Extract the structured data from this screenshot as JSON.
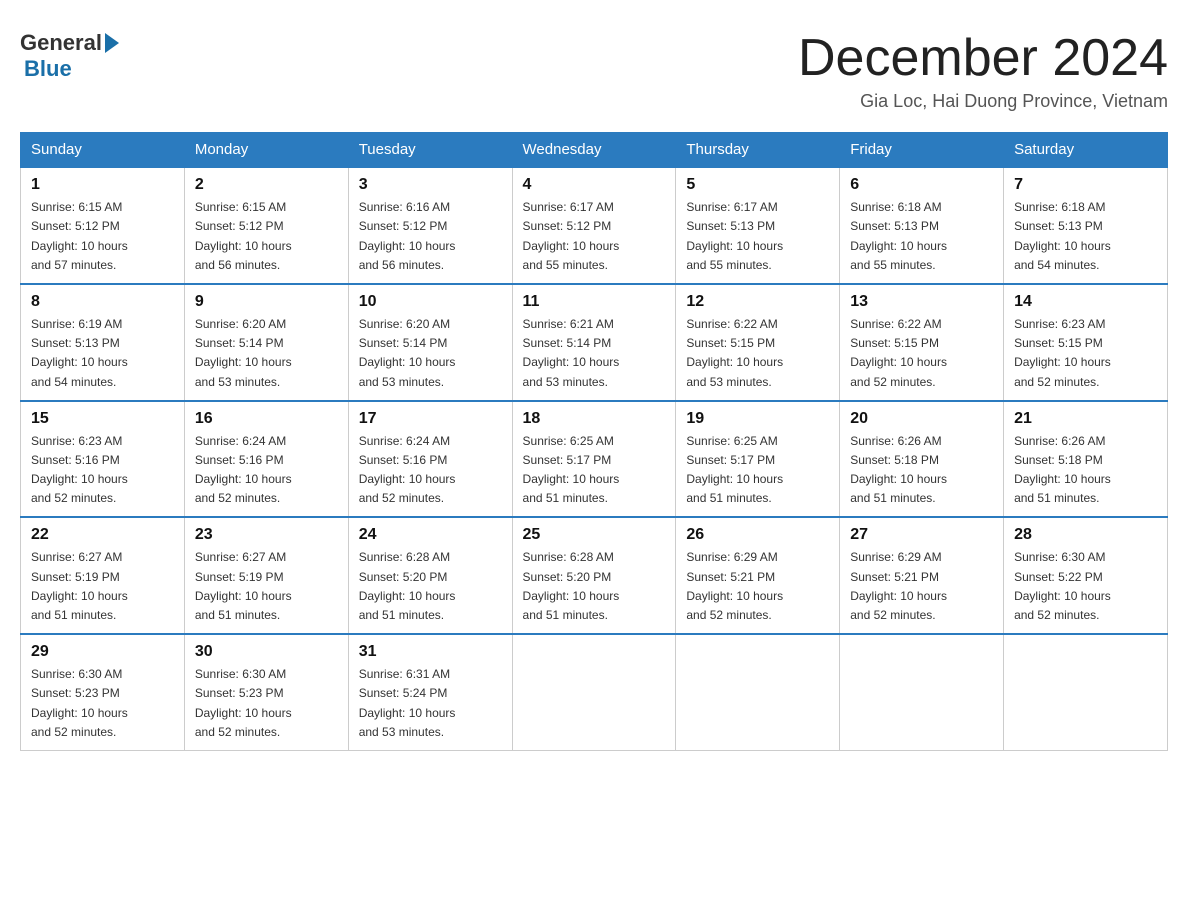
{
  "header": {
    "logo_general": "General",
    "logo_blue": "Blue",
    "title": "December 2024",
    "subtitle": "Gia Loc, Hai Duong Province, Vietnam"
  },
  "days_of_week": [
    "Sunday",
    "Monday",
    "Tuesday",
    "Wednesday",
    "Thursday",
    "Friday",
    "Saturday"
  ],
  "weeks": [
    [
      {
        "day": "1",
        "sunrise": "6:15 AM",
        "sunset": "5:12 PM",
        "daylight": "10 hours and 57 minutes."
      },
      {
        "day": "2",
        "sunrise": "6:15 AM",
        "sunset": "5:12 PM",
        "daylight": "10 hours and 56 minutes."
      },
      {
        "day": "3",
        "sunrise": "6:16 AM",
        "sunset": "5:12 PM",
        "daylight": "10 hours and 56 minutes."
      },
      {
        "day": "4",
        "sunrise": "6:17 AM",
        "sunset": "5:12 PM",
        "daylight": "10 hours and 55 minutes."
      },
      {
        "day": "5",
        "sunrise": "6:17 AM",
        "sunset": "5:13 PM",
        "daylight": "10 hours and 55 minutes."
      },
      {
        "day": "6",
        "sunrise": "6:18 AM",
        "sunset": "5:13 PM",
        "daylight": "10 hours and 55 minutes."
      },
      {
        "day": "7",
        "sunrise": "6:18 AM",
        "sunset": "5:13 PM",
        "daylight": "10 hours and 54 minutes."
      }
    ],
    [
      {
        "day": "8",
        "sunrise": "6:19 AM",
        "sunset": "5:13 PM",
        "daylight": "10 hours and 54 minutes."
      },
      {
        "day": "9",
        "sunrise": "6:20 AM",
        "sunset": "5:14 PM",
        "daylight": "10 hours and 53 minutes."
      },
      {
        "day": "10",
        "sunrise": "6:20 AM",
        "sunset": "5:14 PM",
        "daylight": "10 hours and 53 minutes."
      },
      {
        "day": "11",
        "sunrise": "6:21 AM",
        "sunset": "5:14 PM",
        "daylight": "10 hours and 53 minutes."
      },
      {
        "day": "12",
        "sunrise": "6:22 AM",
        "sunset": "5:15 PM",
        "daylight": "10 hours and 53 minutes."
      },
      {
        "day": "13",
        "sunrise": "6:22 AM",
        "sunset": "5:15 PM",
        "daylight": "10 hours and 52 minutes."
      },
      {
        "day": "14",
        "sunrise": "6:23 AM",
        "sunset": "5:15 PM",
        "daylight": "10 hours and 52 minutes."
      }
    ],
    [
      {
        "day": "15",
        "sunrise": "6:23 AM",
        "sunset": "5:16 PM",
        "daylight": "10 hours and 52 minutes."
      },
      {
        "day": "16",
        "sunrise": "6:24 AM",
        "sunset": "5:16 PM",
        "daylight": "10 hours and 52 minutes."
      },
      {
        "day": "17",
        "sunrise": "6:24 AM",
        "sunset": "5:16 PM",
        "daylight": "10 hours and 52 minutes."
      },
      {
        "day": "18",
        "sunrise": "6:25 AM",
        "sunset": "5:17 PM",
        "daylight": "10 hours and 51 minutes."
      },
      {
        "day": "19",
        "sunrise": "6:25 AM",
        "sunset": "5:17 PM",
        "daylight": "10 hours and 51 minutes."
      },
      {
        "day": "20",
        "sunrise": "6:26 AM",
        "sunset": "5:18 PM",
        "daylight": "10 hours and 51 minutes."
      },
      {
        "day": "21",
        "sunrise": "6:26 AM",
        "sunset": "5:18 PM",
        "daylight": "10 hours and 51 minutes."
      }
    ],
    [
      {
        "day": "22",
        "sunrise": "6:27 AM",
        "sunset": "5:19 PM",
        "daylight": "10 hours and 51 minutes."
      },
      {
        "day": "23",
        "sunrise": "6:27 AM",
        "sunset": "5:19 PM",
        "daylight": "10 hours and 51 minutes."
      },
      {
        "day": "24",
        "sunrise": "6:28 AM",
        "sunset": "5:20 PM",
        "daylight": "10 hours and 51 minutes."
      },
      {
        "day": "25",
        "sunrise": "6:28 AM",
        "sunset": "5:20 PM",
        "daylight": "10 hours and 51 minutes."
      },
      {
        "day": "26",
        "sunrise": "6:29 AM",
        "sunset": "5:21 PM",
        "daylight": "10 hours and 52 minutes."
      },
      {
        "day": "27",
        "sunrise": "6:29 AM",
        "sunset": "5:21 PM",
        "daylight": "10 hours and 52 minutes."
      },
      {
        "day": "28",
        "sunrise": "6:30 AM",
        "sunset": "5:22 PM",
        "daylight": "10 hours and 52 minutes."
      }
    ],
    [
      {
        "day": "29",
        "sunrise": "6:30 AM",
        "sunset": "5:23 PM",
        "daylight": "10 hours and 52 minutes."
      },
      {
        "day": "30",
        "sunrise": "6:30 AM",
        "sunset": "5:23 PM",
        "daylight": "10 hours and 52 minutes."
      },
      {
        "day": "31",
        "sunrise": "6:31 AM",
        "sunset": "5:24 PM",
        "daylight": "10 hours and 53 minutes."
      },
      null,
      null,
      null,
      null
    ]
  ],
  "sunrise_label": "Sunrise:",
  "sunset_label": "Sunset:",
  "daylight_label": "Daylight:"
}
